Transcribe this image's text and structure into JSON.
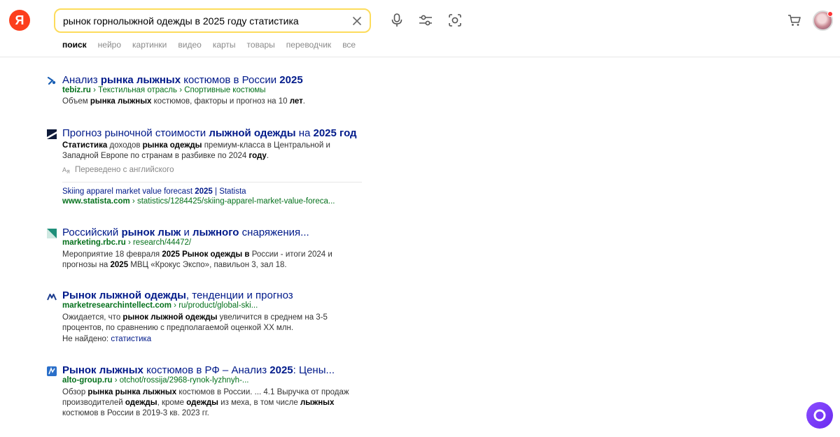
{
  "header": {
    "logo_letter": "Я",
    "search_value": "рынок горнолыжной одежды в 2025 году статистика"
  },
  "tabs": [
    {
      "label": "поиск",
      "active": true
    },
    {
      "label": "нейро"
    },
    {
      "label": "картинки"
    },
    {
      "label": "видео"
    },
    {
      "label": "карты"
    },
    {
      "label": "товары"
    },
    {
      "label": "переводчик"
    },
    {
      "label": "все"
    }
  ],
  "results": [
    {
      "title_html": "Анализ <b>рынка лыжных</b> костюмов в России <b>2025</b>",
      "url_html": "<b>tebiz.ru</b> › Текстильная отрасль › Спортивные костюмы",
      "snippet_html": "Объем <b>рынка лыжных</b> костюмов, факторы и прогноз на 10 <b>лет</b>."
    },
    {
      "title_html": "Прогноз рыночной стоимости <b>лыжной одежды</b> на <b>2025 год</b>",
      "snippet_html": "<b>Статистика</b> доходов <b>рынка одежды</b> премиум-класса в Центральной и Западной Европе по странам в разбивке по 2024 <b>году</b>.",
      "translated": "Переведено с английского",
      "sub_title_html": "Skiing apparel market value forecast <b>2025</b> | Statista",
      "url_html": "<b>www.statista.com</b> › statistics/1284425/skiing-apparel-market-value-foreca..."
    },
    {
      "title_html": "Российский <b>рынок лыж</b> и <b>лыжного</b> снаряжения...",
      "url_html": "<b>marketing.rbc.ru</b> › research/44472/",
      "snippet_html": "Мероприятие 18 февраля <b>2025 Рынок одежды в</b> России - итоги 2024 и прогнозы на <b>2025</b> МВЦ «Крокус Экспо», павильон 3, зал 18."
    },
    {
      "title_html": "<b>Рынок лыжной одежды</b>, тенденции и прогноз",
      "url_html": "<b>marketresearchintellect.com</b> › ru/product/global-ski...",
      "snippet_html": "Ожидается, что <b>рынок лыжной одежды</b> увеличится в среднем на 3-5 процентов, по сравнению с предполагаемой оценкой XX млн.",
      "not_found_label": "Не найдено:",
      "not_found_term": "статистика"
    },
    {
      "title_html": "<b>Рынок лыжных</b> костюмов в РФ – Анализ <b>2025</b>: Цены...",
      "url_html": "<b>alto-group.ru</b> › otchot/rossija/2968-rynok-lyzhnyh-...",
      "snippet_html": "Обзор <b>рынка рынка лыжных</b> костюмов в России. ... 4.1 Выручка от продаж производителей <b>одежды</b>, кроме <b>одежды</b> из меха, в том числе <b>лыжных</b> костюмов в России в 2019-3 кв. 2023 гг."
    }
  ],
  "colors": {
    "logo": "#fc3f1d",
    "search_border": "#fddc5c",
    "link": "#001a8a",
    "url": "#05711c",
    "alice": "#7a3cff"
  }
}
